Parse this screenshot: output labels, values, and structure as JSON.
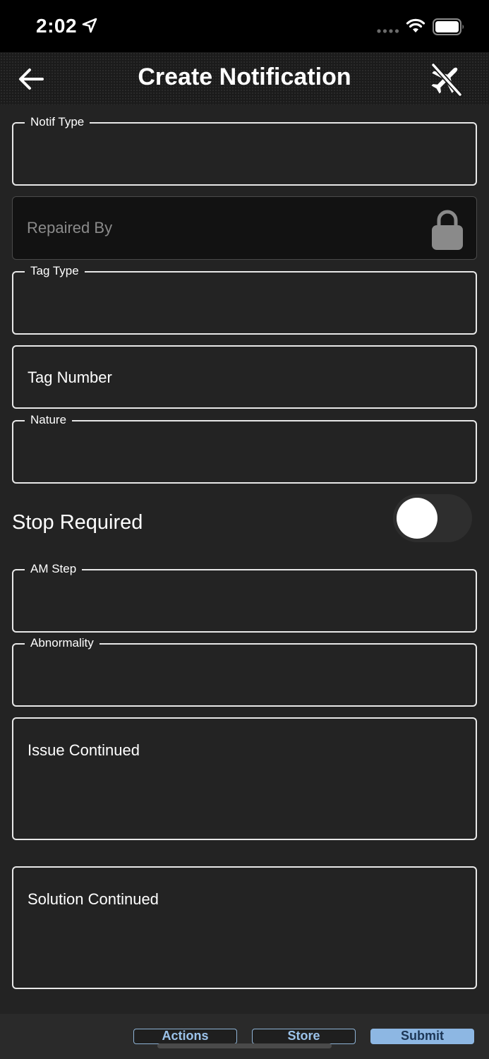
{
  "status_bar": {
    "time": "2:02"
  },
  "nav": {
    "title": "Create Notification"
  },
  "fields": {
    "notif_type": {
      "label": "Notif Type",
      "value": ""
    },
    "repaired_by": {
      "placeholder": "Repaired By",
      "locked": true
    },
    "tag_type": {
      "label": "Tag Type",
      "value": ""
    },
    "tag_number": {
      "placeholder": "Tag Number"
    },
    "nature": {
      "label": "Nature",
      "value": ""
    },
    "am_step": {
      "label": "AM Step",
      "value": ""
    },
    "abnormality": {
      "label": "Abnormality",
      "value": ""
    },
    "issue_continued": {
      "placeholder": "Issue Continued"
    },
    "solution_continued": {
      "placeholder": "Solution Continued"
    }
  },
  "stop_required": {
    "label": "Stop Required",
    "on": false
  },
  "toolbar": {
    "actions": "Actions",
    "store": "Store",
    "submit": "Submit"
  },
  "colors": {
    "background": "#232323",
    "accent": "#8db7e3",
    "border": "#e8e8e8"
  }
}
